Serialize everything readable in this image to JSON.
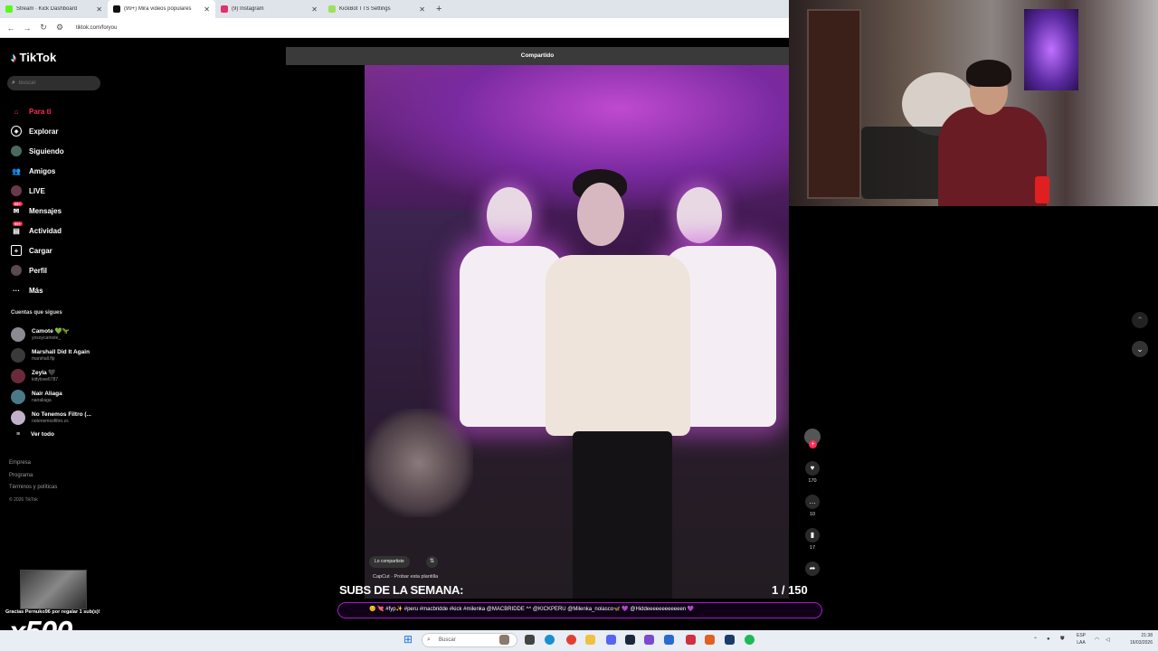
{
  "browser": {
    "tabs": [
      {
        "title": "Stream · Kick Dashboard",
        "color": "#53fc18",
        "active": false
      },
      {
        "title": "(99+) Mira videos populares",
        "color": "#111111",
        "active": true
      },
      {
        "title": "(9) Instagram",
        "color": "#e1306c",
        "active": false
      },
      {
        "title": "KickBot TTS Settings",
        "color": "#9be15d",
        "active": false
      }
    ],
    "new_tab": "+",
    "url": "tiktok.com/foryou"
  },
  "tiktok": {
    "logo": "TikTok",
    "search_placeholder": "Buscar",
    "nav": [
      {
        "label": "Para ti",
        "icon": "home-icon",
        "active": true
      },
      {
        "label": "Explorar",
        "icon": "compass-icon",
        "active": false
      },
      {
        "label": "Siguiendo",
        "icon": "following-icon",
        "active": false
      },
      {
        "label": "Amigos",
        "icon": "friends-icon",
        "active": false
      },
      {
        "label": "LIVE",
        "icon": "live-icon",
        "active": false
      },
      {
        "label": "Mensajes",
        "icon": "messages-icon",
        "active": false,
        "badge": "99+"
      },
      {
        "label": "Actividad",
        "icon": "activity-icon",
        "active": false,
        "badge": "99+"
      },
      {
        "label": "Cargar",
        "icon": "upload-icon",
        "active": false
      },
      {
        "label": "Perfil",
        "icon": "profile-icon",
        "active": false
      },
      {
        "label": "Más",
        "icon": "more-icon",
        "active": false
      }
    ],
    "following_heading": "Cuentas que sigues",
    "following": [
      {
        "name": "Camote 💚🦖",
        "handle": "yosoycamote_"
      },
      {
        "name": "Marshall Did It Again",
        "handle": "marshall.flp"
      },
      {
        "name": "Zeyla 🖤",
        "handle": "kittylove6787"
      },
      {
        "name": "Nair Aliaga",
        "handle": "nairaliaga"
      },
      {
        "name": "No Tenemos Filtro (...",
        "handle": "notenemosfiltro.zs"
      }
    ],
    "see_all": "Ver todo",
    "footer": [
      "Empresa",
      "Programa",
      "Términos y políticas"
    ],
    "copyright": "© 2026 TikTok",
    "shared_label": "Compartido",
    "chip_label": "Lo compartiste",
    "capcut_label": "CapCut · Probar esta plantilla",
    "counts": {
      "likes": "170",
      "comments": "10",
      "saves": "17"
    }
  },
  "overlay": {
    "thanks": "Gracias Pernuko96 por regalar 1 sub(s)!",
    "multiplier": "x500",
    "subs_title": "SUBS DE LA SEMANA:",
    "subs_count": "1 / 150",
    "marquee": "😊 💘 #fyp✨ #peru #macbridde #kick #milenka @MACBRIDDE ^^ @KICKPERU @Milenka_nolasco🦋 💜 @Hiddeeeeeeeeeeeen 💜"
  },
  "taskbar": {
    "search_placeholder": "Buscar",
    "lang_top": "ESP",
    "lang_bottom": "LAA",
    "time": "21:38",
    "date": "16/03/2026"
  }
}
